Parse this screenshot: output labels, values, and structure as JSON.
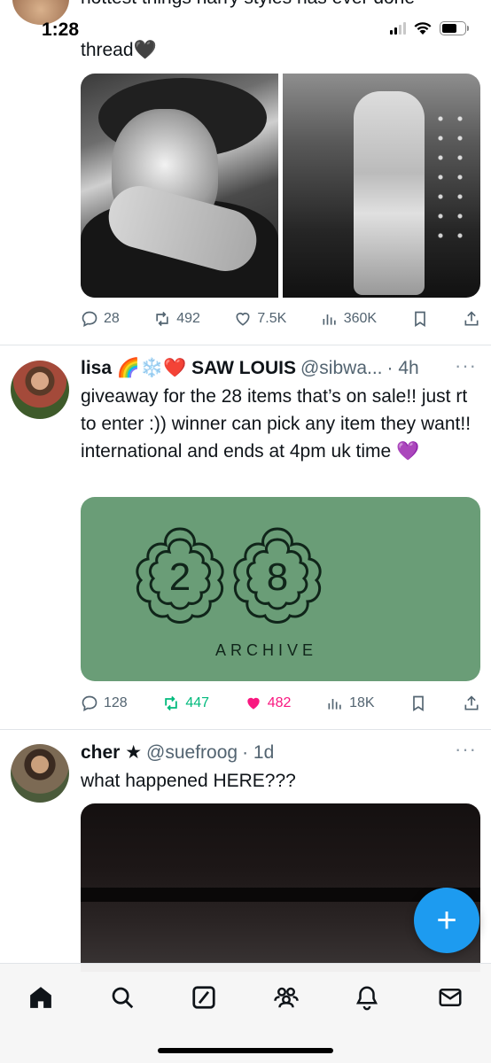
{
  "status_bar": {
    "time": "1:28",
    "signal_icon": "cellular-signal-icon",
    "wifi_icon": "wifi-icon",
    "battery_icon": "battery-icon"
  },
  "previous_tweet": {
    "cut_text": "hottest things harry styles has ever done",
    "text": "thread🖤",
    "actions": {
      "replies": "28",
      "retweets": "492",
      "likes": "7.5K",
      "views": "360K"
    }
  },
  "tweets": [
    {
      "name": "lisa 🌈❄️❤️ SAW LOUIS",
      "handle": "@sibwa...",
      "time": "· 4h",
      "text": "giveaway for the 28 items that’s on sale!! just rt to enter :)) winner can pick any item they want!! international and ends at 4pm uk time 💜",
      "card": {
        "number_left": "2",
        "number_right": "8",
        "label": "ARCHIVE",
        "bg_color": "#6a9d77"
      },
      "actions": {
        "replies": "128",
        "retweets": "447",
        "likes": "482",
        "views": "18K"
      },
      "retweet_color": "#00ba7c",
      "like_color": "#f91880"
    },
    {
      "name": "cher ★",
      "handle": "@suefroog",
      "time": "· 1d",
      "text": "what happened HERE???"
    }
  ],
  "more_label": "···",
  "fab_label": "+",
  "tab_bar": [
    "home-icon",
    "search-icon",
    "grok-icon",
    "communities-icon",
    "notifications-icon",
    "messages-icon"
  ],
  "colors": {
    "accent": "#1d9bf0",
    "muted": "#536471"
  }
}
